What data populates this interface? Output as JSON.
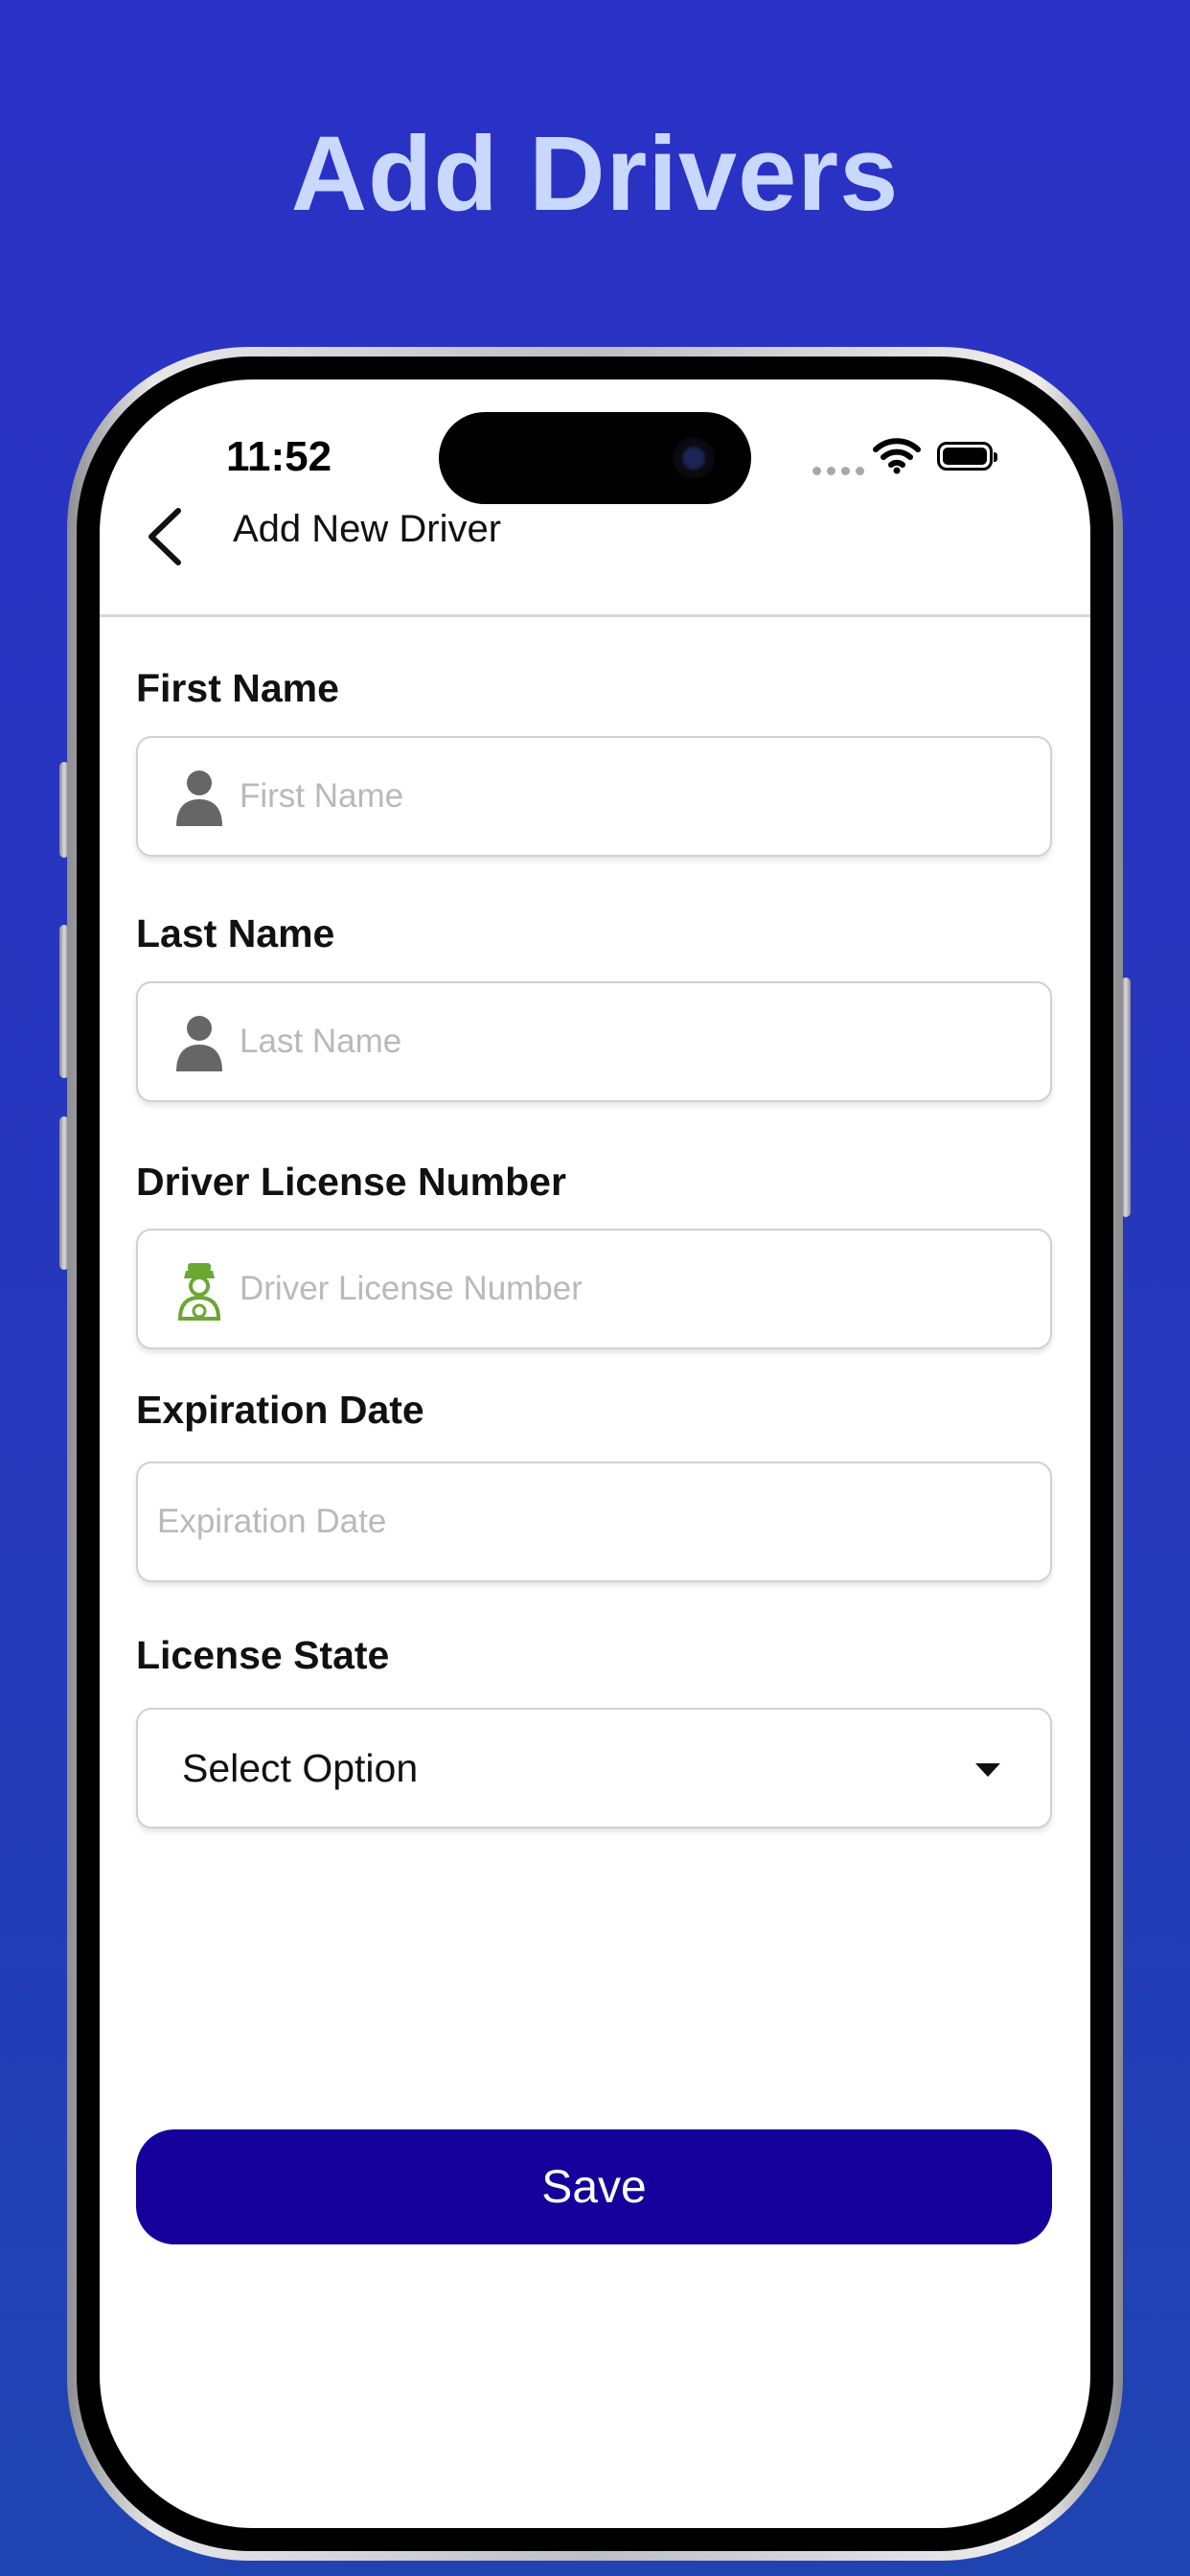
{
  "hero": {
    "title": "Add Drivers"
  },
  "status_bar": {
    "time": "11:52"
  },
  "nav": {
    "title": "Add New Driver"
  },
  "form": {
    "first_name": {
      "label": "First Name",
      "placeholder": "First Name",
      "icon": "person-icon"
    },
    "last_name": {
      "label": "Last Name",
      "placeholder": "Last Name",
      "icon": "person-icon"
    },
    "license_number": {
      "label": "Driver License Number",
      "placeholder": "Driver License Number",
      "icon": "driver-icon"
    },
    "expiration_date": {
      "label": "Expiration Date",
      "placeholder": "Expiration Date"
    },
    "license_state": {
      "label": "License State",
      "value": "Select Option"
    }
  },
  "actions": {
    "save_label": "Save"
  },
  "colors": {
    "background": "#2b31c6",
    "hero_text": "#c9d8ff",
    "primary_button": "#16009b",
    "driver_icon": "#6aa832"
  }
}
